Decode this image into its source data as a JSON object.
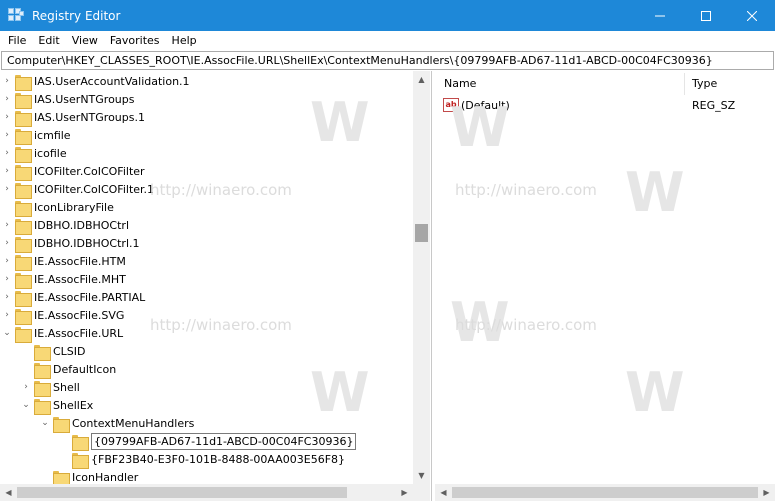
{
  "window": {
    "title": "Registry Editor",
    "minimize_glyph": "—",
    "maximize_glyph": "☐",
    "close_glyph": "✕"
  },
  "menu": [
    "File",
    "Edit",
    "View",
    "Favorites",
    "Help"
  ],
  "address": "Computer\\HKEY_CLASSES_ROOT\\IE.AssocFile.URL\\ShellEx\\ContextMenuHandlers\\{09799AFB-AD67-11d1-ABCD-00C04FC30936}",
  "tree": [
    {
      "label": "IAS.UserAccountValidation.1",
      "depth": 0,
      "expander": "›"
    },
    {
      "label": "IAS.UserNTGroups",
      "depth": 0,
      "expander": "›"
    },
    {
      "label": "IAS.UserNTGroups.1",
      "depth": 0,
      "expander": "›"
    },
    {
      "label": "icmfile",
      "depth": 0,
      "expander": "›"
    },
    {
      "label": "icofile",
      "depth": 0,
      "expander": "›"
    },
    {
      "label": "ICOFilter.CoICOFilter",
      "depth": 0,
      "expander": "›"
    },
    {
      "label": "ICOFilter.CoICOFilter.1",
      "depth": 0,
      "expander": "›"
    },
    {
      "label": "IconLibraryFile",
      "depth": 0,
      "expander": ""
    },
    {
      "label": "IDBHO.IDBHOCtrl",
      "depth": 0,
      "expander": "›"
    },
    {
      "label": "IDBHO.IDBHOCtrl.1",
      "depth": 0,
      "expander": "›"
    },
    {
      "label": "IE.AssocFile.HTM",
      "depth": 0,
      "expander": "›"
    },
    {
      "label": "IE.AssocFile.MHT",
      "depth": 0,
      "expander": "›"
    },
    {
      "label": "IE.AssocFile.PARTIAL",
      "depth": 0,
      "expander": "›"
    },
    {
      "label": "IE.AssocFile.SVG",
      "depth": 0,
      "expander": "›"
    },
    {
      "label": "IE.AssocFile.URL",
      "depth": 0,
      "expander": "⌄"
    },
    {
      "label": "CLSID",
      "depth": 1,
      "expander": ""
    },
    {
      "label": "DefaultIcon",
      "depth": 1,
      "expander": ""
    },
    {
      "label": "Shell",
      "depth": 1,
      "expander": "›"
    },
    {
      "label": "ShellEx",
      "depth": 1,
      "expander": "⌄"
    },
    {
      "label": "ContextMenuHandlers",
      "depth": 2,
      "expander": "⌄"
    },
    {
      "label": "{09799AFB-AD67-11d1-ABCD-00C04FC30936}",
      "depth": 3,
      "expander": "",
      "selected": true
    },
    {
      "label": "{FBF23B40-E3F0-101B-8488-00AA003E56F8}",
      "depth": 3,
      "expander": ""
    },
    {
      "label": "IconHandler",
      "depth": 2,
      "expander": ""
    }
  ],
  "values": {
    "columns": {
      "name": "Name",
      "type": "Type"
    },
    "rows": [
      {
        "name": "(Default)",
        "type": "REG_SZ",
        "icon": "ab"
      }
    ]
  },
  "watermark": {
    "letter": "W",
    "text": "http://winaero.com"
  },
  "colors": {
    "titlebar": "#1e88d8",
    "folder": "#f8d876"
  }
}
